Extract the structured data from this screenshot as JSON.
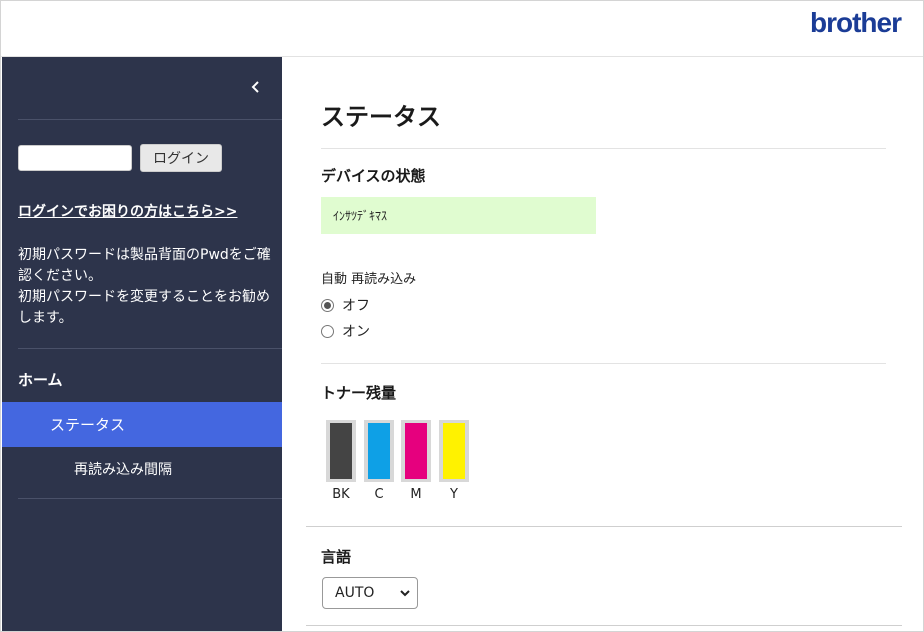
{
  "brand": {
    "logo_text": "brother",
    "color": "#1b3c96"
  },
  "sidebar": {
    "collapse_icon": "chevron-left-icon",
    "login": {
      "input_value": "",
      "button_label": "ログイン"
    },
    "help_link": "ログインでお困りの方はこちら>>",
    "notice_line1": "初期パスワードは製品背面のPwdをご確認ください。",
    "notice_line2": "初期パスワードを変更することをお勧めします。",
    "nav": {
      "home": "ホーム",
      "status": "ステータス",
      "reload_interval": "再読み込み間隔"
    },
    "colors": {
      "background": "#2d344b",
      "active": "#4467e0"
    }
  },
  "main": {
    "title": "ステータス",
    "device_status": {
      "heading": "デバイスの状態",
      "value": "ｲﾝｻﾂﾃﾞｷﾏｽ",
      "color": "#e0fcd0"
    },
    "auto_reload": {
      "label": "自動 再読み込み",
      "options": [
        {
          "label": "オフ",
          "selected": true
        },
        {
          "label": "オン",
          "selected": false
        }
      ]
    },
    "toner": {
      "heading": "トナー残量",
      "items": [
        {
          "label": "BK",
          "color": "#444444",
          "level": 1.0
        },
        {
          "label": "C",
          "color": "#0ea0e6",
          "level": 1.0
        },
        {
          "label": "M",
          "color": "#e6007e",
          "level": 1.0
        },
        {
          "label": "Y",
          "color": "#fff200",
          "level": 1.0
        }
      ]
    },
    "language": {
      "heading": "言語",
      "selected": "AUTO"
    }
  }
}
